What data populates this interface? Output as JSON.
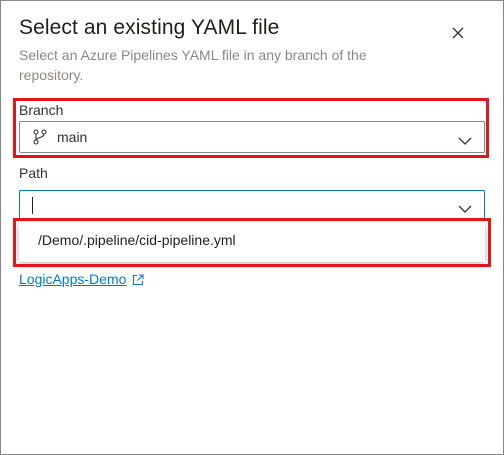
{
  "dialog": {
    "title": "Select an existing YAML file",
    "subtitle": "Select an Azure Pipelines YAML file in any branch of the repository.",
    "close_icon": "close-icon"
  },
  "branch": {
    "label": "Branch",
    "value": "main",
    "icon": "branch-icon"
  },
  "path": {
    "label": "Path",
    "value": "",
    "suggestions": [
      "/Demo/.pipeline/cid-pipeline.yml"
    ]
  },
  "repository": {
    "link_text": "LogicApps-Demo",
    "icon": "external-link-icon"
  },
  "colors": {
    "accent": "#0078d4",
    "highlight": "#e3151a",
    "subtle_text": "#8a8886"
  }
}
